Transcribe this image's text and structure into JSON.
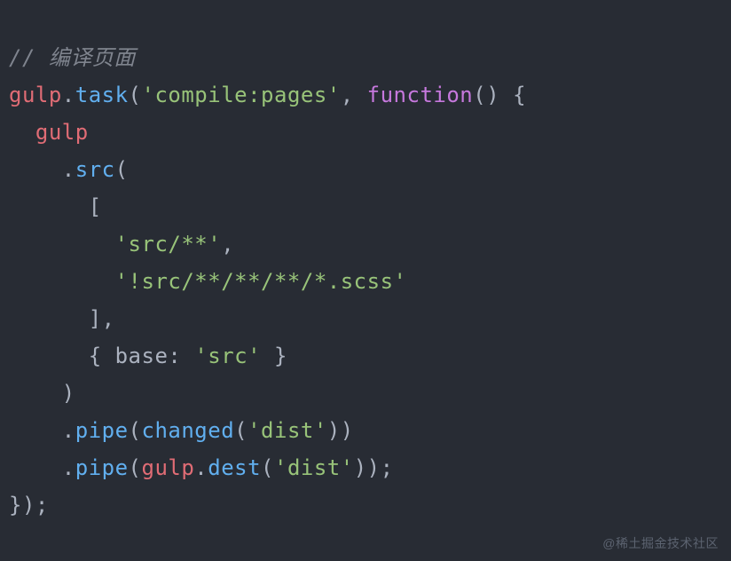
{
  "code": {
    "line1_comment": "// 编译页面",
    "line2_gulp": "gulp",
    "line2_dot": ".",
    "line2_task": "task",
    "line2_open": "(",
    "line2_str": "'compile:pages'",
    "line2_comma": ", ",
    "line2_func": "function",
    "line2_funcparen": "()",
    "line2_brace": " {",
    "line3_indent": "  ",
    "line3_gulp": "gulp",
    "line4_indent": "    ",
    "line4_dot": ".",
    "line4_src": "src",
    "line4_open": "(",
    "line5_indent": "      ",
    "line5_bracket": "[",
    "line6_indent": "        ",
    "line6_str": "'src/**'",
    "line6_comma": ",",
    "line7_indent": "        ",
    "line7_str": "'!src/**/**/**/*.scss'",
    "line8_indent": "      ",
    "line8_bracket": "],",
    "line9_indent": "      ",
    "line9_obj_open": "{ ",
    "line9_base": "base",
    "line9_colon": ": ",
    "line9_str": "'src'",
    "line9_obj_close": " }",
    "line10_indent": "    ",
    "line10_close": ")",
    "line11_indent": "    ",
    "line11_dot": ".",
    "line11_pipe": "pipe",
    "line11_open": "(",
    "line11_changed": "changed",
    "line11_open2": "(",
    "line11_str": "'dist'",
    "line11_close": "))",
    "line12_indent": "    ",
    "line12_dot": ".",
    "line12_pipe": "pipe",
    "line12_open": "(",
    "line12_gulp": "gulp",
    "line12_dot2": ".",
    "line12_dest": "dest",
    "line12_open2": "(",
    "line12_str": "'dist'",
    "line12_close": "));",
    "line13_close": "});"
  },
  "watermark": "@稀土掘金技术社区"
}
